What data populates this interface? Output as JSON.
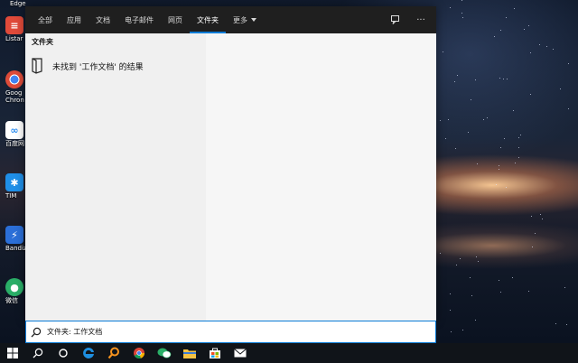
{
  "desktop": {
    "top_label": "Edge",
    "icons": [
      {
        "label": "Listar",
        "icon": "listar-app-icon",
        "color": "#e04a3a"
      },
      {
        "label": "Goog\nChron",
        "icon": "chrome-icon",
        "color": "#dd4b39"
      },
      {
        "label": "百度网",
        "icon": "baidu-netdisk-icon",
        "color": "#2a8cf0"
      },
      {
        "label": "TIM",
        "icon": "tim-icon",
        "color": "#1f8fe8"
      },
      {
        "label": "Bandiz",
        "icon": "bandizip-icon",
        "color": "#2b6fd8"
      },
      {
        "label": "微信",
        "icon": "wechat-icon",
        "color": "#2aae67"
      }
    ]
  },
  "search_panel": {
    "tabs": [
      {
        "label": "全部",
        "active": false
      },
      {
        "label": "应用",
        "active": false
      },
      {
        "label": "文档",
        "active": false
      },
      {
        "label": "电子邮件",
        "active": false
      },
      {
        "label": "网页",
        "active": false
      },
      {
        "label": "文件夹",
        "active": true
      },
      {
        "label": "更多",
        "active": false
      }
    ],
    "feedback_icon": "feedback-icon",
    "more_options_label": "···",
    "section_title": "文件夹",
    "result_text": "未找到 '工作文档' 的结果",
    "accent": "#0a7bd6"
  },
  "search_box": {
    "value": "文件夹: 工作文档"
  },
  "taskbar": {
    "items": [
      "windows-start-icon",
      "search-icon",
      "task-view-icon",
      "edge-icon",
      "search-app-icon",
      "chrome-icon",
      "wechat-icon",
      "file-explorer-icon",
      "store-icon",
      "mail-icon"
    ]
  }
}
